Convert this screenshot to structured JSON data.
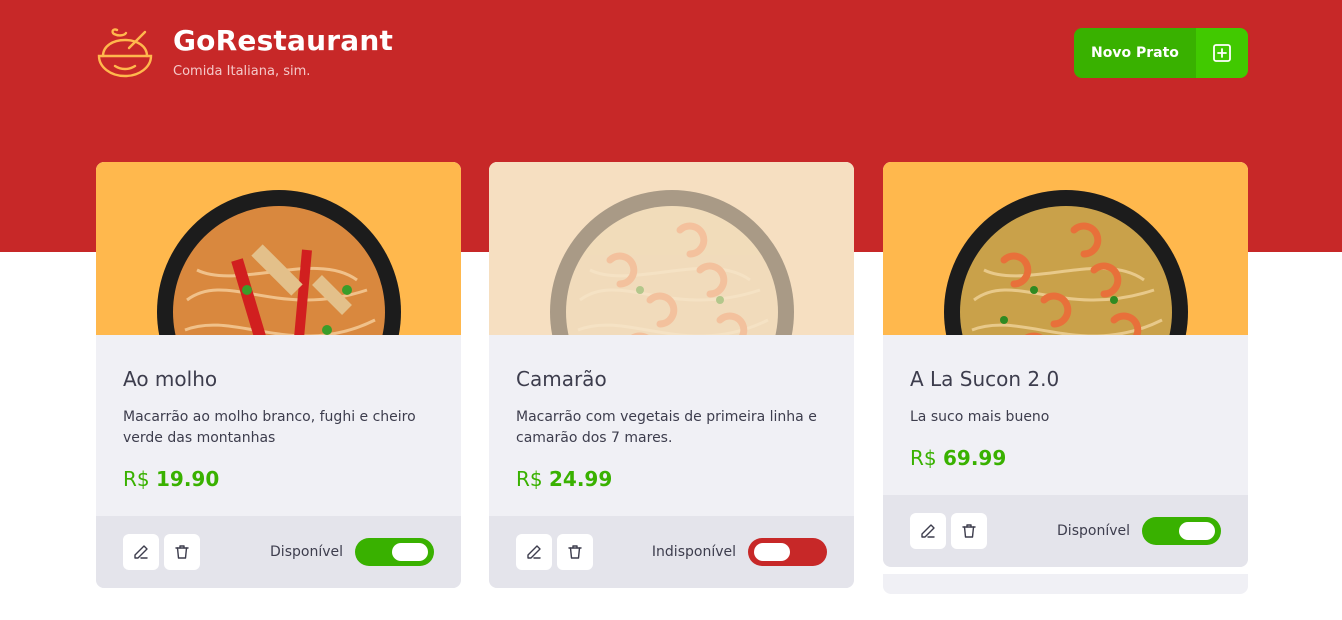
{
  "brand": {
    "title": "GoRestaurant",
    "subtitle": "Comida Italiana, sim.",
    "logo_icon": "bowl-icon"
  },
  "header": {
    "new_dish_label": "Novo Prato",
    "new_dish_icon": "plus-square-icon"
  },
  "colors": {
    "header_red": "#c72828",
    "green": "#39b100",
    "green_light": "#41c900",
    "card_bg": "#f0f0f5",
    "footer_bg": "#e4e4eb",
    "image_bg": "#ffb84d"
  },
  "foods": [
    {
      "name": "Ao molho",
      "description": "Macarrão ao molho branco, fughi e cheiro verde das montanhas",
      "currency": "R$",
      "price": "19.90",
      "availability_label": "Disponível",
      "available": true
    },
    {
      "name": "Camarão",
      "description": "Macarrão com vegetais de primeira linha e camarão dos 7 mares.",
      "currency": "R$",
      "price": "24.99",
      "availability_label": "Indisponível",
      "available": false
    },
    {
      "name": "A La Sucon 2.0",
      "description": "La suco mais bueno",
      "currency": "R$",
      "price": "69.99",
      "availability_label": "Disponível",
      "available": true
    }
  ]
}
